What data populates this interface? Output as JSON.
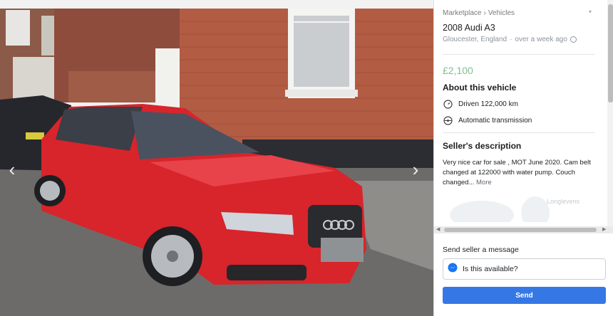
{
  "listing": {
    "breadcrumb": [
      "Marketplace",
      "Vehicles"
    ],
    "breadcrumb_separator": "›",
    "title": "2008 Audi A3",
    "location": "Gloucester, England",
    "posted": "over a week ago",
    "location_separator": "·",
    "price": "£2,100",
    "price_color": "#7fc08e"
  },
  "about": {
    "heading": "About this vehicle",
    "specs": [
      {
        "icon": "speedometer-icon",
        "text": "Driven 122,000 km"
      },
      {
        "icon": "steering-wheel-icon",
        "text": "Automatic transmission"
      }
    ]
  },
  "description": {
    "heading": "Seller's description",
    "text": "Very nice car for sale , MOT June 2020.  Cam belt changed at 122000 with water pump. Couch changed... ",
    "more_label": "More"
  },
  "map": {
    "label": "Longlevens"
  },
  "message": {
    "label": "Send seller a message",
    "input_value": "Is this available?",
    "send_label": "Send",
    "accent": "#3578e5"
  },
  "gallery": {
    "prev_icon": "chevron-left-icon",
    "next_icon": "chevron-right-icon",
    "car_color": "#d8242b"
  }
}
